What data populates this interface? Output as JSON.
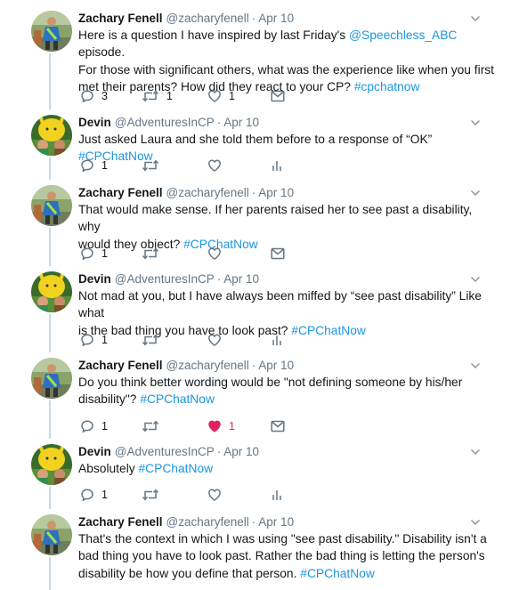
{
  "tweets": [
    {
      "name": "Zachary Fenell",
      "handle": "@zacharyfenell",
      "sep": "·",
      "time": "Apr 10",
      "avatar": "zachary",
      "lines": [
        [
          {
            "t": "Here is a question I have inspired by last Friday's "
          },
          {
            "t": "@Speechless_ABC",
            "link": true
          },
          {
            "t": " episode."
          }
        ],
        [
          {
            "t": "For those with significant others, what was the experience like when you first"
          }
        ],
        [
          {
            "t": "met their parents? How did they react to your CP? "
          },
          {
            "t": "#cpchatnow",
            "link": true
          }
        ]
      ],
      "reply_count": "3",
      "retweet_count": "1",
      "like_count": "1",
      "liked": false,
      "last_action": "message-icon"
    },
    {
      "name": "Devin",
      "handle": "@AdventuresInCP",
      "sep": "·",
      "time": "Apr 10",
      "avatar": "devin",
      "lines": [
        [
          {
            "t": "Just asked Laura and she told them before to a response of “OK” "
          },
          {
            "t": "#CPChatNow",
            "link": true
          }
        ]
      ],
      "reply_count": "1",
      "retweet_count": "",
      "like_count": "",
      "liked": false,
      "last_action": "analytics-icon"
    },
    {
      "name": "Zachary Fenell",
      "handle": "@zacharyfenell",
      "sep": "·",
      "time": "Apr 10",
      "avatar": "zachary",
      "lines": [
        [
          {
            "t": "That would make sense. If her parents raised her to see past a disability, why"
          }
        ],
        [
          {
            "t": "would they object? "
          },
          {
            "t": "#CPChatNow",
            "link": true
          }
        ]
      ],
      "reply_count": "1",
      "retweet_count": "",
      "like_count": "",
      "liked": false,
      "last_action": "message-icon"
    },
    {
      "name": "Devin",
      "handle": "@AdventuresInCP",
      "sep": "·",
      "time": "Apr 10",
      "avatar": "devin",
      "lines": [
        [
          {
            "t": "Not mad at you, but I have always been miffed by “see past disability” Like what"
          }
        ],
        [
          {
            "t": "is the bad thing you have to look past? "
          },
          {
            "t": "#CPChatNow",
            "link": true
          }
        ]
      ],
      "reply_count": "1",
      "retweet_count": "",
      "like_count": "",
      "liked": false,
      "last_action": "analytics-icon"
    },
    {
      "name": "Zachary Fenell",
      "handle": "@zacharyfenell",
      "sep": "·",
      "time": "Apr 10",
      "avatar": "zachary",
      "lines": [
        [
          {
            "t": "Do you think better wording would be \"not defining someone by his/her"
          }
        ],
        [
          {
            "t": "disability\"? "
          },
          {
            "t": "#CPChatNow",
            "link": true
          }
        ]
      ],
      "reply_count": "1",
      "retweet_count": "",
      "like_count": "1",
      "liked": true,
      "last_action": "message-icon"
    },
    {
      "name": "Devin",
      "handle": "@AdventuresInCP",
      "sep": "·",
      "time": "Apr 10",
      "avatar": "devin",
      "lines": [
        [
          {
            "t": "Absolutely "
          },
          {
            "t": "#CPChatNow",
            "link": true
          }
        ]
      ],
      "reply_count": "1",
      "retweet_count": "",
      "like_count": "",
      "liked": false,
      "last_action": "analytics-icon"
    },
    {
      "name": "Zachary Fenell",
      "handle": "@zacharyfenell",
      "sep": "·",
      "time": "Apr 10",
      "avatar": "zachary",
      "lines": [
        [
          {
            "t": "That's the context in which I was using \"see past disability.\" Disability isn't a"
          }
        ],
        [
          {
            "t": "bad thing you have to look past. Rather the bad thing is letting the person's"
          }
        ],
        [
          {
            "t": "disability be how you define that person. "
          },
          {
            "t": "#CPChatNow",
            "link": true
          }
        ]
      ],
      "reply_count": "",
      "retweet_count": "",
      "like_count": "",
      "liked": false,
      "last_action": ""
    }
  ],
  "colors": {
    "link": "#1b95e0",
    "muted": "#657786",
    "liked": "#e0245e",
    "thread_line": "#c4dbec"
  }
}
